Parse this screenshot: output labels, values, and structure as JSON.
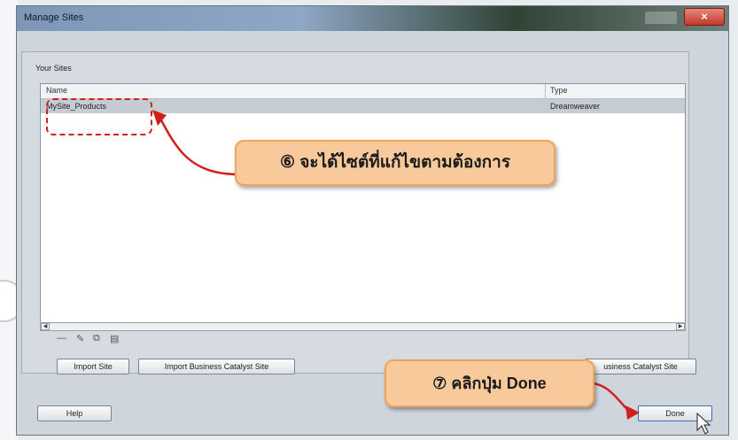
{
  "window": {
    "title": "Manage Sites",
    "close_glyph": "×"
  },
  "sites_panel": {
    "label": "Your Sites",
    "columns": [
      "Name",
      "Type"
    ],
    "rows": [
      {
        "name": "MySite_Products",
        "type": "Dreamweaver"
      }
    ]
  },
  "toolbar": {
    "remove_icon": "minus-icon",
    "edit_icon": "pencil-icon",
    "duplicate_icon": "duplicate-icon",
    "export_icon": "export-icon"
  },
  "buttons": {
    "import_site": "Import Site",
    "import_bc": "Import Business Catalyst Site",
    "new_bc": "usiness Catalyst Site",
    "help": "Help",
    "done": "Done"
  },
  "annotations": {
    "step6": "⑥ จะได้ไซต์ที่แก้ไขตามต้องการ",
    "step7": "⑦ คลิกปุ่ม Done"
  },
  "colors": {
    "annotation_red": "#d1201a",
    "callout_fill": "#f8c99b"
  }
}
